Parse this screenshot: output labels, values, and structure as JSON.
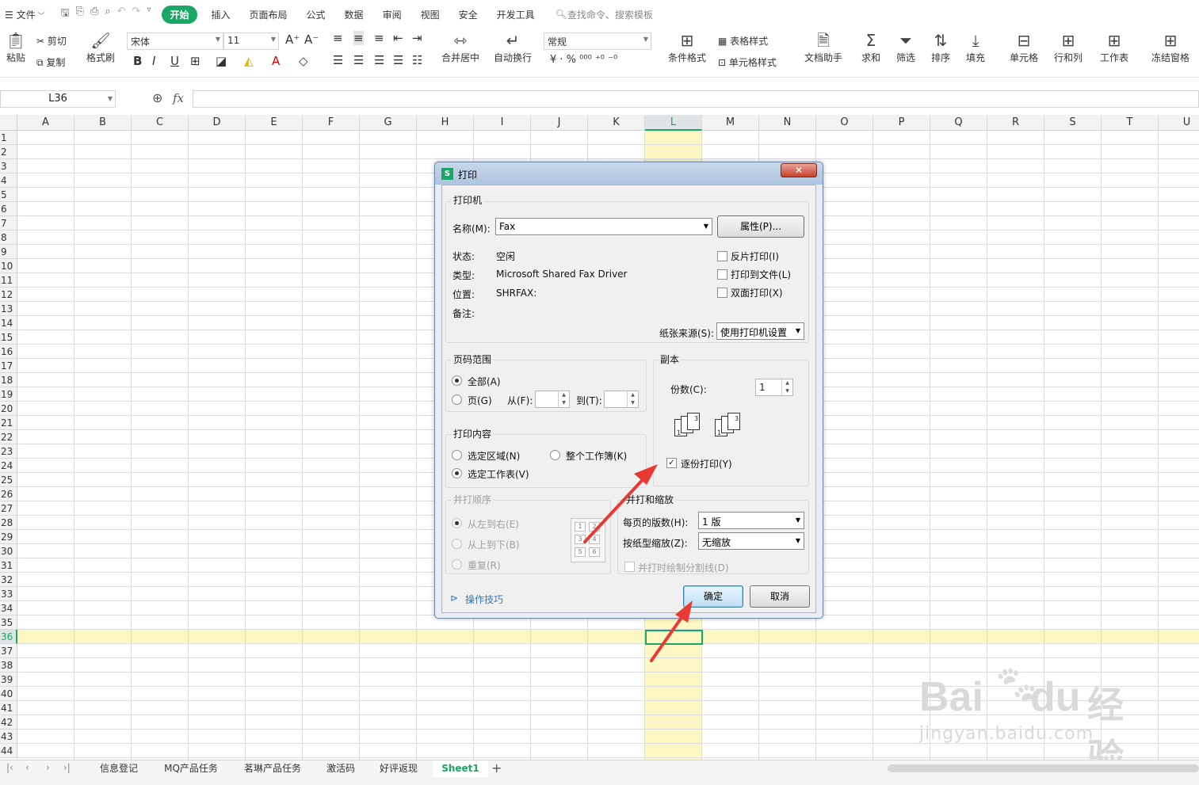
{
  "menubar": {
    "file": "文件",
    "tabs": [
      "开始",
      "插入",
      "页面布局",
      "公式",
      "数据",
      "审阅",
      "视图",
      "安全",
      "开发工具"
    ],
    "search": "查找命令、搜索模板"
  },
  "ribbon": {
    "paste": "粘贴",
    "cut": "剪切",
    "copy": "复制",
    "format_painter": "格式刷",
    "font_name": "宋体",
    "font_size": "11",
    "merge_center": "合并居中",
    "wrap_text": "自动换行",
    "number_format": "常规",
    "cond_format": "条件格式",
    "table_style": "表格样式",
    "cell_style": "单元格样式",
    "doc_helper": "文档助手",
    "sum": "求和",
    "filter": "筛选",
    "sort": "排序",
    "fill": "填充",
    "cell": "单元格",
    "rowcol": "行和列",
    "worksheet": "工作表",
    "freeze": "冻结窗格"
  },
  "formula": {
    "cell_ref": "L36",
    "fx": "fx"
  },
  "columns": [
    "A",
    "B",
    "C",
    "D",
    "E",
    "F",
    "G",
    "H",
    "I",
    "J",
    "K",
    "L",
    "M",
    "N",
    "O",
    "P",
    "Q",
    "R",
    "S",
    "T",
    "U"
  ],
  "rows": [
    "1",
    "2",
    "3",
    "4",
    "5",
    "6",
    "7",
    "8",
    "9",
    "10",
    "11",
    "12",
    "13",
    "14",
    "15",
    "16",
    "17",
    "18",
    "19",
    "20",
    "21",
    "22",
    "23",
    "24",
    "25",
    "26",
    "27",
    "28",
    "29",
    "30",
    "31",
    "32",
    "33",
    "34",
    "35",
    "36",
    "37",
    "38",
    "39",
    "40",
    "41",
    "42",
    "43",
    "44"
  ],
  "dialog": {
    "title": "打印",
    "printer_group": "打印机",
    "name_label": "名称(M):",
    "printer_name": "Fax",
    "properties_btn": "属性(P)...",
    "status_label": "状态:",
    "status_value": "空闲",
    "type_label": "类型:",
    "type_value": "Microsoft Shared Fax Driver",
    "location_label": "位置:",
    "location_value": "SHRFAX:",
    "comment_label": "备注:",
    "reverse_print": "反片打印(I)",
    "print_to_file": "打印到文件(L)",
    "duplex": "双面打印(X)",
    "paper_source_label": "纸张来源(S):",
    "paper_source_value": "使用打印机设置",
    "range_group": "页码范围",
    "range_all": "全部(A)",
    "range_pages": "页(G)",
    "from_label": "从(F):",
    "to_label": "到(T):",
    "copies_group": "副本",
    "copies_label": "份数(C):",
    "copies_value": "1",
    "collate": "逐份打印(Y)",
    "content_group": "打印内容",
    "content_selection": "选定区域(N)",
    "content_workbook": "整个工作簿(K)",
    "content_sheet": "选定工作表(V)",
    "order_group": "并打顺序",
    "order_lr": "从左到右(E)",
    "order_tb": "从上到下(B)",
    "order_repeat": "重复(R)",
    "order_grid": [
      "1",
      "2",
      "3",
      "4",
      "5",
      "6"
    ],
    "scale_group": "并打和缩放",
    "pages_per_sheet_label": "每页的版数(H):",
    "pages_per_sheet_value": "1 版",
    "scale_label": "按纸型缩放(Z):",
    "scale_value": "无缩放",
    "draw_lines": "并打时绘制分割线(D)",
    "tips": "操作技巧",
    "ok": "确定",
    "cancel": "取消"
  },
  "sheets": [
    "信息登记",
    "MQ产品任务",
    "茗琳产品任务",
    "激活码",
    "好评返现",
    "Sheet1"
  ],
  "watermark": {
    "brand": "Bai",
    "brand2": "du",
    "cn": "经验",
    "url": "jingyan.baidu.com"
  },
  "colors": {
    "accent": "#1aa664",
    "highlight": "#fdf7c3",
    "arrow": "#e83a32"
  }
}
